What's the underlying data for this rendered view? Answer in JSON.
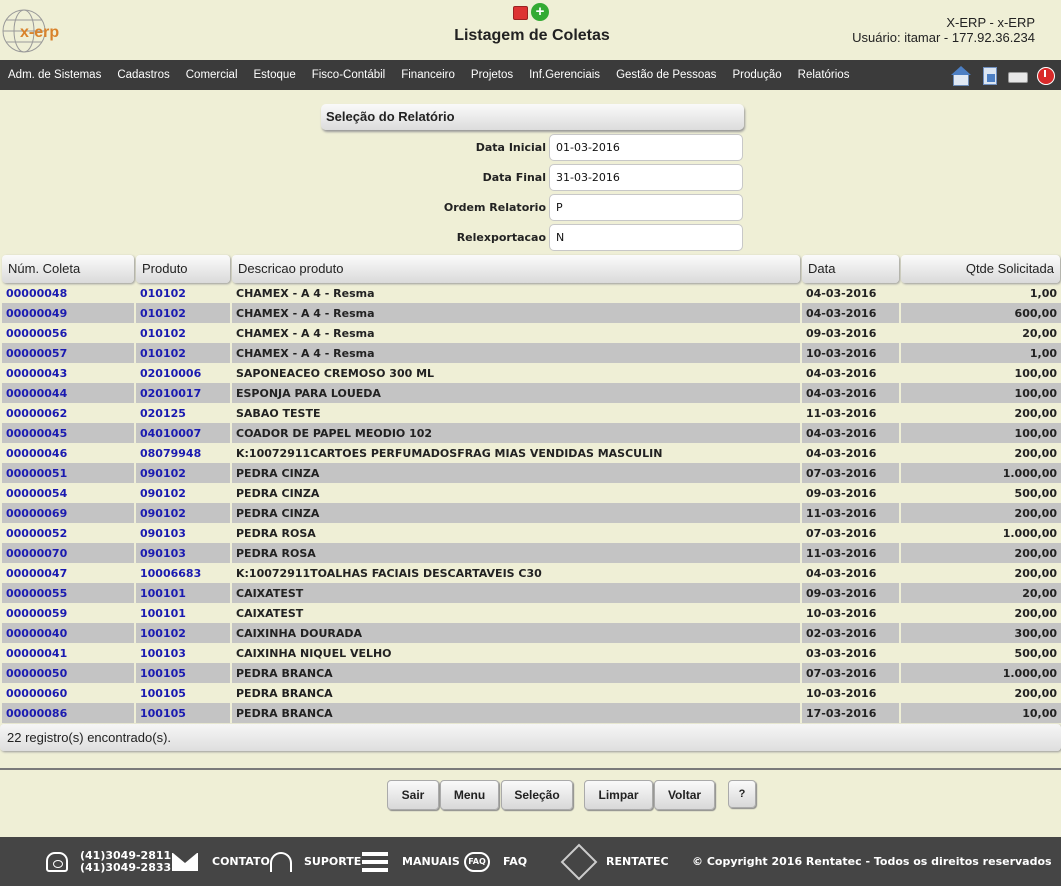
{
  "header": {
    "logo_text": "x-erp",
    "title": "Listagem de Coletas",
    "app_name": "X-ERP - x-ERP",
    "user": "Usuário: itamar - 177.92.36.234"
  },
  "menu": {
    "items": [
      {
        "label": "Adm. de Sistemas"
      },
      {
        "label": "Cadastros"
      },
      {
        "label": "Comercial"
      },
      {
        "label": "Estoque"
      },
      {
        "label": "Fisco-Contábil"
      },
      {
        "label": "Financeiro"
      },
      {
        "label": "Projetos"
      },
      {
        "label": "Inf.Gerenciais"
      },
      {
        "label": "Gestão de Pessoas"
      },
      {
        "label": "Produção"
      },
      {
        "label": "Relatórios"
      }
    ],
    "tools": [
      "home-icon",
      "document-icon",
      "print-icon",
      "power-icon"
    ]
  },
  "selection": {
    "title": "Seleção do Relatório",
    "fields": [
      {
        "label": "Data Inicial",
        "value": "01-03-2016"
      },
      {
        "label": "Data Final",
        "value": "31-03-2016"
      },
      {
        "label": "Ordem Relatorio",
        "value": "P"
      },
      {
        "label": "Relexportacao",
        "value": "N"
      }
    ]
  },
  "table": {
    "columns": [
      "Núm. Coleta",
      "Produto",
      "Descricao produto",
      "Data",
      "Qtde Solicitada"
    ],
    "rows": [
      {
        "coleta": "00000048",
        "produto": "010102",
        "descricao": "CHAMEX - A 4 - Resma",
        "data": "04-03-2016",
        "qtde": "1,00"
      },
      {
        "coleta": "00000049",
        "produto": "010102",
        "descricao": "CHAMEX - A 4 - Resma",
        "data": "04-03-2016",
        "qtde": "600,00"
      },
      {
        "coleta": "00000056",
        "produto": "010102",
        "descricao": "CHAMEX - A 4 - Resma",
        "data": "09-03-2016",
        "qtde": "20,00"
      },
      {
        "coleta": "00000057",
        "produto": "010102",
        "descricao": "CHAMEX - A 4 - Resma",
        "data": "10-03-2016",
        "qtde": "1,00"
      },
      {
        "coleta": "00000043",
        "produto": "02010006",
        "descricao": "SAPONEACEO CREMOSO 300 ML",
        "data": "04-03-2016",
        "qtde": "100,00"
      },
      {
        "coleta": "00000044",
        "produto": "02010017",
        "descricao": "ESPONJA PARA LOUEDA",
        "data": "04-03-2016",
        "qtde": "100,00"
      },
      {
        "coleta": "00000062",
        "produto": "020125",
        "descricao": "SABAO TESTE",
        "data": "11-03-2016",
        "qtde": "200,00"
      },
      {
        "coleta": "00000045",
        "produto": "04010007",
        "descricao": "COADOR DE PAPEL MEODIO 102",
        "data": "04-03-2016",
        "qtde": "100,00"
      },
      {
        "coleta": "00000046",
        "produto": "08079948",
        "descricao": "K:10072911CARTOES PERFUMADOSFRAG MIAS VENDIDAS MASCULIN",
        "data": "04-03-2016",
        "qtde": "200,00"
      },
      {
        "coleta": "00000051",
        "produto": "090102",
        "descricao": "PEDRA CINZA",
        "data": "07-03-2016",
        "qtde": "1.000,00"
      },
      {
        "coleta": "00000054",
        "produto": "090102",
        "descricao": "PEDRA CINZA",
        "data": "09-03-2016",
        "qtde": "500,00"
      },
      {
        "coleta": "00000069",
        "produto": "090102",
        "descricao": "PEDRA CINZA",
        "data": "11-03-2016",
        "qtde": "200,00"
      },
      {
        "coleta": "00000052",
        "produto": "090103",
        "descricao": "PEDRA ROSA",
        "data": "07-03-2016",
        "qtde": "1.000,00"
      },
      {
        "coleta": "00000070",
        "produto": "090103",
        "descricao": "PEDRA ROSA",
        "data": "11-03-2016",
        "qtde": "200,00"
      },
      {
        "coleta": "00000047",
        "produto": "10006683",
        "descricao": "K:10072911TOALHAS FACIAIS DESCARTAVEIS C30",
        "data": "04-03-2016",
        "qtde": "200,00"
      },
      {
        "coleta": "00000055",
        "produto": "100101",
        "descricao": "CAIXATEST",
        "data": "09-03-2016",
        "qtde": "20,00"
      },
      {
        "coleta": "00000059",
        "produto": "100101",
        "descricao": "CAIXATEST",
        "data": "10-03-2016",
        "qtde": "200,00"
      },
      {
        "coleta": "00000040",
        "produto": "100102",
        "descricao": "CAIXINHA DOURADA",
        "data": "02-03-2016",
        "qtde": "300,00"
      },
      {
        "coleta": "00000041",
        "produto": "100103",
        "descricao": "CAIXINHA NIQUEL VELHO",
        "data": "03-03-2016",
        "qtde": "500,00"
      },
      {
        "coleta": "00000050",
        "produto": "100105",
        "descricao": "PEDRA BRANCA",
        "data": "07-03-2016",
        "qtde": "1.000,00"
      },
      {
        "coleta": "00000060",
        "produto": "100105",
        "descricao": "PEDRA BRANCA",
        "data": "10-03-2016",
        "qtde": "200,00"
      },
      {
        "coleta": "00000086",
        "produto": "100105",
        "descricao": "PEDRA BRANCA",
        "data": "17-03-2016",
        "qtde": "10,00"
      }
    ],
    "count_text": "22 registro(s) encontrado(s)."
  },
  "buttons": {
    "sair": "Sair",
    "menu": "Menu",
    "selecao": "Seleção",
    "limpar": "Limpar",
    "voltar": "Voltar",
    "help": "?"
  },
  "footer": {
    "phone1": "(41)3049-2811",
    "phone2": "(41)3049-2833",
    "contato": "CONTATO",
    "suporte": "SUPORTE",
    "manuais": "MANUAIS",
    "faq": "FAQ",
    "faq_icon_text": "FAQ",
    "rentatec": "RENTATEC",
    "copyright": "© Copyright 2016 Rentatec - Todos os direitos reservados"
  },
  "colors": {
    "background": "#efefd6",
    "menubar": "#3b3b3b",
    "link": "#1a1ab0",
    "row_alt": "#c4c4c4",
    "footer": "#454545"
  }
}
